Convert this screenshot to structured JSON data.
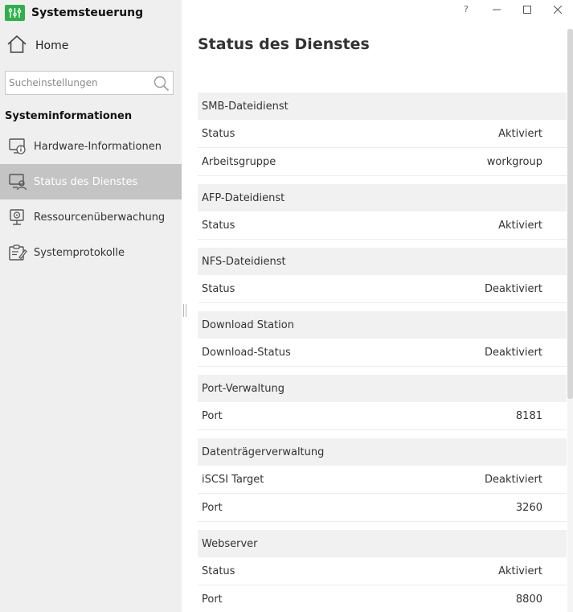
{
  "app": {
    "title": "Systemsteuerung",
    "logo_icon": "settings-sliders-icon",
    "accent_color": "#2eb04b"
  },
  "window_controls": {
    "help": "?",
    "minimize": "–",
    "maximize": "☐",
    "close": "✕"
  },
  "sidebar": {
    "home_label": "Home",
    "search_placeholder": "Sucheinstellungen",
    "section_heading": "Systeminformationen",
    "items": [
      {
        "label": "Hardware-Informationen",
        "icon": "hardware-info-icon",
        "active": false
      },
      {
        "label": "Status des Dienstes",
        "icon": "service-status-icon",
        "active": true
      },
      {
        "label": "Ressourcenüberwachung",
        "icon": "resource-monitor-icon",
        "active": false
      },
      {
        "label": "Systemprotokolle",
        "icon": "system-log-icon",
        "active": false
      }
    ]
  },
  "main": {
    "title": "Status des Dienstes",
    "groups": [
      {
        "name": "SMB-Dateidienst",
        "rows": [
          {
            "label": "Status",
            "value": "Aktiviert"
          },
          {
            "label": "Arbeitsgruppe",
            "value": "workgroup"
          }
        ]
      },
      {
        "name": "AFP-Dateidienst",
        "rows": [
          {
            "label": "Status",
            "value": "Aktiviert"
          }
        ]
      },
      {
        "name": "NFS-Dateidienst",
        "rows": [
          {
            "label": "Status",
            "value": "Deaktiviert"
          }
        ]
      },
      {
        "name": "Download Station",
        "rows": [
          {
            "label": "Download-Status",
            "value": "Deaktiviert"
          }
        ]
      },
      {
        "name": "Port-Verwaltung",
        "rows": [
          {
            "label": "Port",
            "value": "8181"
          }
        ]
      },
      {
        "name": "Datenträgerverwaltung",
        "rows": [
          {
            "label": "iSCSI Target",
            "value": "Deaktiviert"
          },
          {
            "label": "Port",
            "value": "3260"
          }
        ]
      },
      {
        "name": "Webserver",
        "rows": [
          {
            "label": "Status",
            "value": "Aktiviert"
          },
          {
            "label": "Port",
            "value": "8800"
          }
        ]
      }
    ]
  }
}
